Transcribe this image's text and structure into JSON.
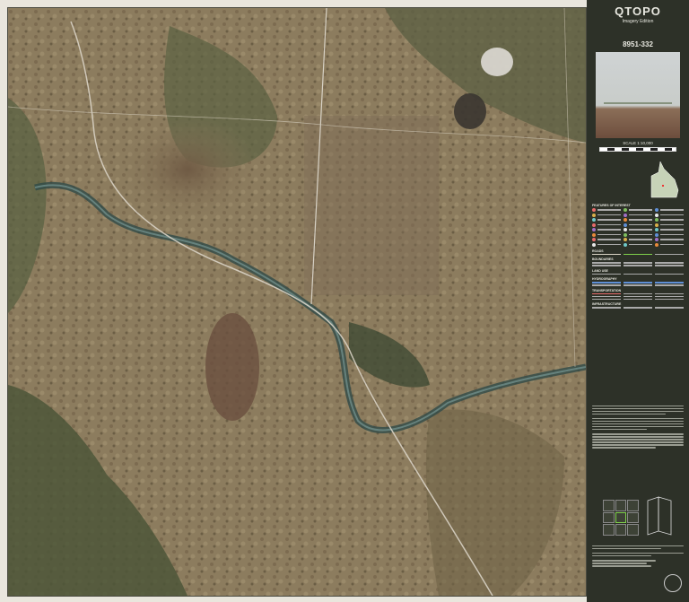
{
  "panel": {
    "title": "QTOPO",
    "subtitle": "Imagery Edition",
    "sheet_number": "8951-332",
    "scale_text": "SCALE 1:10,000"
  },
  "legend": {
    "sections": [
      "FEATURES OF INTEREST",
      "ROADS",
      "BOUNDARIES",
      "LAND USE",
      "HYDROGRAPHY",
      "TRANSPORTATION",
      "INFRASTRUCTURE"
    ]
  },
  "colors": {
    "panel_bg": "#2d3128",
    "terrain": "#8a7a5c",
    "vegetation": "#4f5a3c",
    "river": "#3f5c5a",
    "road": "#d8d2c4",
    "index_current": "#7fd04b"
  },
  "icons": [
    "camera-photo",
    "queensland-locator-map",
    "map-index-grid",
    "folded-map-icon",
    "crest-icon"
  ]
}
